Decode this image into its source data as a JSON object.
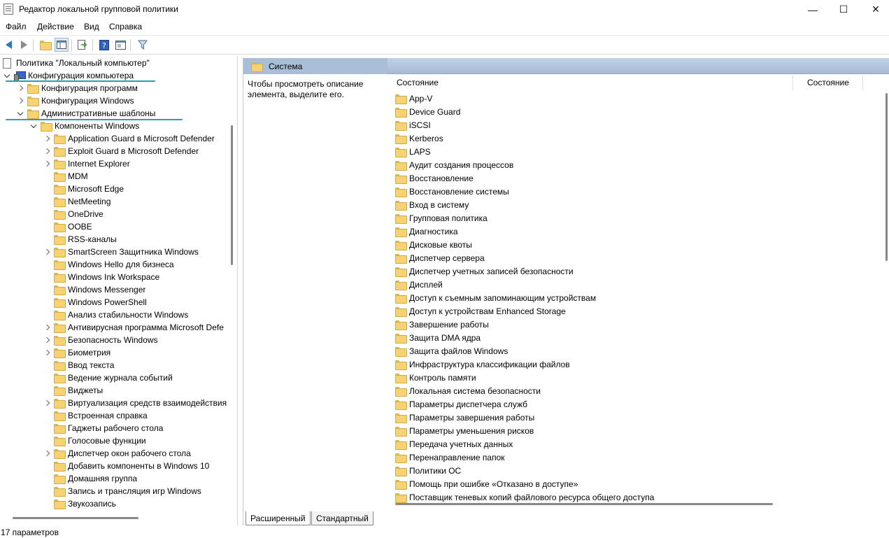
{
  "window": {
    "title": "Редактор локальной групповой политики",
    "minimize_glyph": "—",
    "maximize_glyph": "☐",
    "close_glyph": "✕"
  },
  "menu": [
    "Файл",
    "Действие",
    "Вид",
    "Справка"
  ],
  "toolbar": [
    "back-icon",
    "forward-icon",
    "up-folder-icon",
    "show-hide-tree-icon",
    "export-list-icon",
    "help-icon",
    "properties-view-icon",
    "filter-icon"
  ],
  "tree": {
    "root": "Политика \"Локальный компьютер\"",
    "computer_config": "Конфигурация компьютера",
    "program_config": "Конфигурация программ",
    "windows_config": "Конфигурация Windows",
    "admin_templates": "Административные шаблоны",
    "windows_components": "Компоненты Windows",
    "items": [
      {
        "label": "Application Guard в Microsoft Defender",
        "expandable": true
      },
      {
        "label": "Exploit Guard в Microsoft Defender",
        "expandable": true
      },
      {
        "label": "Internet Explorer",
        "expandable": true
      },
      {
        "label": "MDM",
        "expandable": false
      },
      {
        "label": "Microsoft Edge",
        "expandable": false
      },
      {
        "label": "NetMeeting",
        "expandable": false
      },
      {
        "label": "OneDrive",
        "expandable": false
      },
      {
        "label": "OOBE",
        "expandable": false
      },
      {
        "label": "RSS-каналы",
        "expandable": false
      },
      {
        "label": "SmartScreen Защитника Windows",
        "expandable": true
      },
      {
        "label": "Windows Hello для бизнеса",
        "expandable": false
      },
      {
        "label": "Windows Ink Workspace",
        "expandable": false
      },
      {
        "label": "Windows Messenger",
        "expandable": false
      },
      {
        "label": "Windows PowerShell",
        "expandable": false
      },
      {
        "label": "Анализ стабильности Windows",
        "expandable": false
      },
      {
        "label": "Антивирусная программа Microsoft Defe",
        "expandable": true
      },
      {
        "label": "Безопасность Windows",
        "expandable": true
      },
      {
        "label": "Биометрия",
        "expandable": true
      },
      {
        "label": "Ввод текста",
        "expandable": false
      },
      {
        "label": "Ведение журнала событий",
        "expandable": false
      },
      {
        "label": "Виджеты",
        "expandable": false
      },
      {
        "label": "Виртуализация средств взаимодействия",
        "expandable": true
      },
      {
        "label": "Встроенная справка",
        "expandable": false
      },
      {
        "label": "Гаджеты рабочего стола",
        "expandable": false
      },
      {
        "label": "Голосовые функции",
        "expandable": false
      },
      {
        "label": "Диспетчер окон рабочего стола",
        "expandable": true
      },
      {
        "label": "Добавить компоненты в Windows 10",
        "expandable": false
      },
      {
        "label": "Домашняя группа",
        "expandable": false
      },
      {
        "label": "Запись и трансляция игр Windows",
        "expandable": false
      },
      {
        "label": "Звукозапись",
        "expandable": false
      }
    ]
  },
  "right": {
    "header": "Система",
    "description": "Чтобы просмотреть описание элемента, выделите его.",
    "col_name": "Состояние",
    "col_state": "Состояние",
    "items": [
      "App-V",
      "Device Guard",
      "iSCSI",
      "Kerberos",
      "LAPS",
      "Аудит создания процессов",
      "Восстановление",
      "Восстановление системы",
      "Вход в систему",
      "Групповая политика",
      "Диагностика",
      "Дисковые квоты",
      "Диспетчер сервера",
      "Диспетчер учетных записей безопасности",
      "Дисплей",
      "Доступ к съемным запоминающим устройствам",
      "Доступ к устройствам Enhanced Storage",
      "Завершение работы",
      "Защита DMA ядра",
      "Защита файлов Windows",
      "Инфраструктура классификации файлов",
      "Контроль памяти",
      "Локальная система безопасности",
      "Параметры диспетчера служб",
      "Параметры завершения работы",
      "Параметры уменьшения рисков",
      "Передача учетных данных",
      "Перенаправление папок",
      "Политики ОС",
      "Помощь при ошибке «Отказано в доступе»",
      "Поставщик теневых копий файлового ресурса общего доступа"
    ]
  },
  "tabs": {
    "extended": "Расширенный",
    "standard": "Стандартный"
  },
  "status": "17 параметров"
}
